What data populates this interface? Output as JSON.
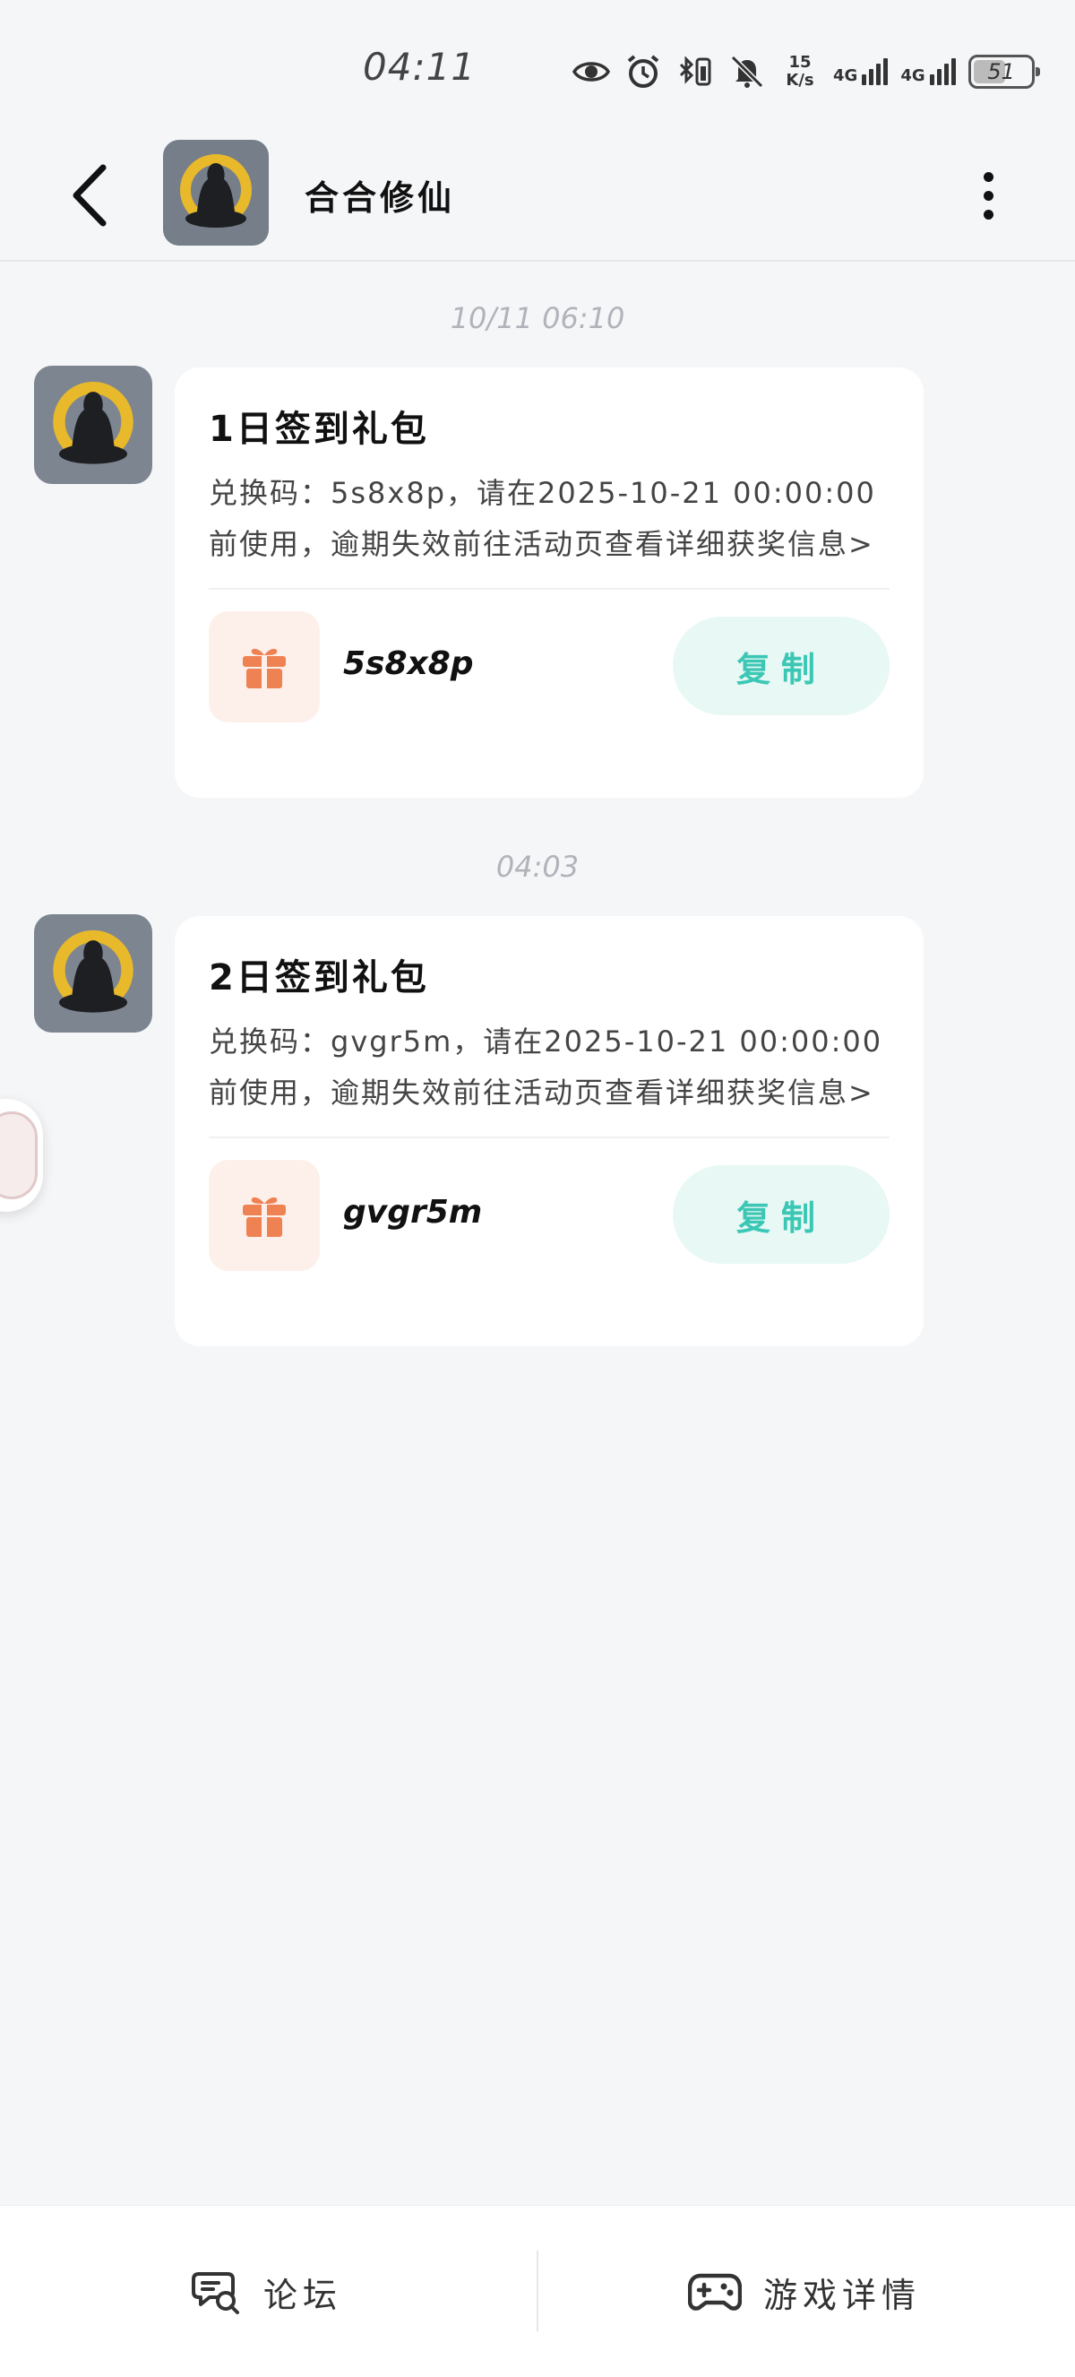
{
  "status_bar": {
    "time": "04:11",
    "net_speed_value": "15",
    "net_speed_unit": "K/s",
    "signal_1": "4G",
    "signal_2": "4G",
    "battery": "51"
  },
  "header": {
    "title": "合合修仙"
  },
  "messages": [
    {
      "timestamp": "10/11 06:10",
      "title": "1日签到礼包",
      "description": "兑换码：5s8x8p，请在2025-10-21 00:00:00前使用，逾期失效前往活动页查看详细获奖信息>",
      "code": "5s8x8p",
      "copy_label": "复制"
    },
    {
      "timestamp": "04:03",
      "title": "2日签到礼包",
      "description": "兑换码：gvgr5m，请在2025-10-21 00:00:00前使用，逾期失效前往活动页查看详细获奖信息>",
      "code": "gvgr5m",
      "copy_label": "复制"
    }
  ],
  "bottom_nav": {
    "forum_label": "论坛",
    "game_detail_label": "游戏详情"
  },
  "colors": {
    "accent_teal": "#3cc7b5",
    "gift_orange": "#ef8253",
    "background": "#f5f6f8"
  },
  "icons": {
    "back": "chevron-left-icon",
    "more": "more-vertical-icon",
    "gift": "gift-icon",
    "forum": "chat-search-icon",
    "game": "gamepad-icon"
  }
}
